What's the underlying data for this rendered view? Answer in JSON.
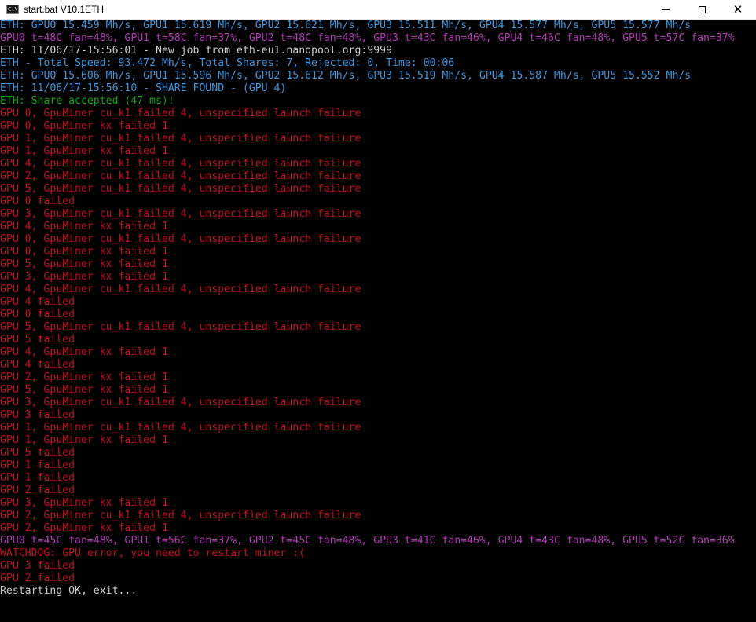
{
  "window": {
    "title": "start.bat V10.1ETH",
    "icon_label": "C:\\",
    "controls": {
      "minimize": "minimize",
      "maximize": "maximize",
      "close": "✕"
    }
  },
  "colors": {
    "cyan": "#3a96dd",
    "magenta": "#b039b2",
    "white": "#cccccc",
    "green": "#13a10e",
    "red": "#c50f1f",
    "background": "#000000"
  },
  "console": {
    "lines": [
      {
        "color": "cyan",
        "text": "ETH: GPU0 15.459 Mh/s, GPU1 15.619 Mh/s, GPU2 15.621 Mh/s, GPU3 15.511 Mh/s, GPU4 15.577 Mh/s, GPU5 15.577 Mh/s"
      },
      {
        "color": "magenta",
        "text": "GPU0 t=48C fan=48%, GPU1 t=58C fan=37%, GPU2 t=48C fan=48%, GPU3 t=43C fan=46%, GPU4 t=46C fan=48%, GPU5 t=57C fan=37%"
      },
      {
        "color": "white",
        "text": "ETH: 11/06/17-15:56:01 - New job from eth-eu1.nanopool.org:9999"
      },
      {
        "color": "cyan",
        "text": "ETH - Total Speed: 93.472 Mh/s, Total Shares: 7, Rejected: 0, Time: 00:06"
      },
      {
        "color": "cyan",
        "text": "ETH: GPU0 15.606 Mh/s, GPU1 15.596 Mh/s, GPU2 15.612 Mh/s, GPU3 15.519 Mh/s, GPU4 15.587 Mh/s, GPU5 15.552 Mh/s"
      },
      {
        "color": "cyan",
        "text": "ETH: 11/06/17-15:56:10 - SHARE FOUND - (GPU 4)"
      },
      {
        "color": "green",
        "text": "ETH: Share accepted (47 ms)!"
      },
      {
        "color": "red",
        "text": "GPU 0, GpuMiner cu_k1 failed 4, unspecified launch failure"
      },
      {
        "color": "red",
        "text": "GPU 0, GpuMiner kx failed 1"
      },
      {
        "color": "red",
        "text": "GPU 1, GpuMiner cu_k1 failed 4, unspecified launch failure"
      },
      {
        "color": "red",
        "text": "GPU 1, GpuMiner kx failed 1"
      },
      {
        "color": "red",
        "text": "GPU 4, GpuMiner cu_k1 failed 4, unspecified launch failure"
      },
      {
        "color": "red",
        "text": "GPU 2, GpuMiner cu_k1 failed 4, unspecified launch failure"
      },
      {
        "color": "red",
        "text": "GPU 5, GpuMiner cu_k1 failed 4, unspecified launch failure"
      },
      {
        "color": "red",
        "text": "GPU 0 failed"
      },
      {
        "color": "red",
        "text": "GPU 3, GpuMiner cu_k1 failed 4, unspecified launch failure"
      },
      {
        "color": "red",
        "text": "GPU 4, GpuMiner kx failed 1"
      },
      {
        "color": "red",
        "text": "GPU 0, GpuMiner cu_k1 failed 4, unspecified launch failure"
      },
      {
        "color": "red",
        "text": "GPU 0, GpuMiner kx failed 1"
      },
      {
        "color": "red",
        "text": "GPU 5, GpuMiner kx failed 1"
      },
      {
        "color": "red",
        "text": "GPU 3, GpuMiner kx failed 1"
      },
      {
        "color": "red",
        "text": "GPU 4, GpuMiner cu_k1 failed 4, unspecified launch failure"
      },
      {
        "color": "red",
        "text": "GPU 4 failed"
      },
      {
        "color": "red",
        "text": "GPU 0 failed"
      },
      {
        "color": "red",
        "text": "GPU 5, GpuMiner cu_k1 failed 4, unspecified launch failure"
      },
      {
        "color": "red",
        "text": "GPU 5 failed"
      },
      {
        "color": "red",
        "text": "GPU 4, GpuMiner kx failed 1"
      },
      {
        "color": "red",
        "text": "GPU 4 failed"
      },
      {
        "color": "red",
        "text": "GPU 2, GpuMiner kx failed 1"
      },
      {
        "color": "red",
        "text": "GPU 5, GpuMiner kx failed 1"
      },
      {
        "color": "red",
        "text": "GPU 3, GpuMiner cu_k1 failed 4, unspecified launch failure"
      },
      {
        "color": "red",
        "text": "GPU 3 failed"
      },
      {
        "color": "red",
        "text": "GPU 1, GpuMiner cu_k1 failed 4, unspecified launch failure"
      },
      {
        "color": "red",
        "text": "GPU 1, GpuMiner kx failed 1"
      },
      {
        "color": "red",
        "text": "GPU 5 failed"
      },
      {
        "color": "red",
        "text": "GPU 1 failed"
      },
      {
        "color": "red",
        "text": "GPU 1 failed"
      },
      {
        "color": "red",
        "text": "GPU 2 failed"
      },
      {
        "color": "red",
        "text": "GPU 3, GpuMiner kx failed 1"
      },
      {
        "color": "red",
        "text": "GPU 2, GpuMiner cu_k1 failed 4, unspecified launch failure"
      },
      {
        "color": "red",
        "text": "GPU 2, GpuMiner kx failed 1"
      },
      {
        "color": "magenta",
        "text": "GPU0 t=45C fan=48%, GPU1 t=56C fan=37%, GPU2 t=45C fan=48%, GPU3 t=41C fan=46%, GPU4 t=43C fan=48%, GPU5 t=52C fan=36%"
      },
      {
        "color": "red",
        "text": "WATCHDOG: GPU error, you need to restart miner :("
      },
      {
        "color": "red",
        "text": "GPU 3 failed"
      },
      {
        "color": "red",
        "text": "GPU 2 failed"
      },
      {
        "color": "white",
        "text": "Restarting OK, exit..."
      }
    ]
  }
}
